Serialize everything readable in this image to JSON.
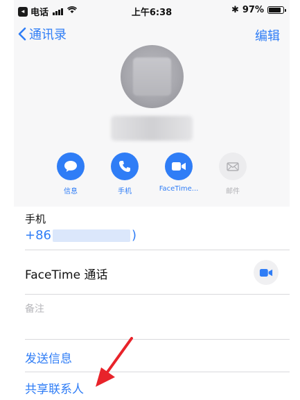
{
  "status_bar": {
    "app_badge": "◂",
    "carrier": "电话",
    "time": "上午6:38",
    "bluetooth": "✱",
    "battery_percent": "97%"
  },
  "nav": {
    "back_label": "通讯录",
    "edit_label": "编辑"
  },
  "actions": [
    {
      "label": "信息",
      "icon": "message-icon",
      "enabled": true
    },
    {
      "label": "手机",
      "icon": "phone-icon",
      "enabled": true
    },
    {
      "label": "FaceTime...",
      "icon": "video-icon",
      "enabled": true
    },
    {
      "label": "邮件",
      "icon": "mail-icon",
      "enabled": false
    }
  ],
  "details": {
    "phone_label": "手机",
    "phone_prefix": "+86",
    "phone_suffix": ")",
    "facetime_label": "FaceTime 通话",
    "notes_label": "备注",
    "send_message_label": "发送信息",
    "share_contact_label": "共享联系人"
  },
  "colors": {
    "accent": "#2f7df6",
    "annotation_arrow": "#e8232a"
  }
}
